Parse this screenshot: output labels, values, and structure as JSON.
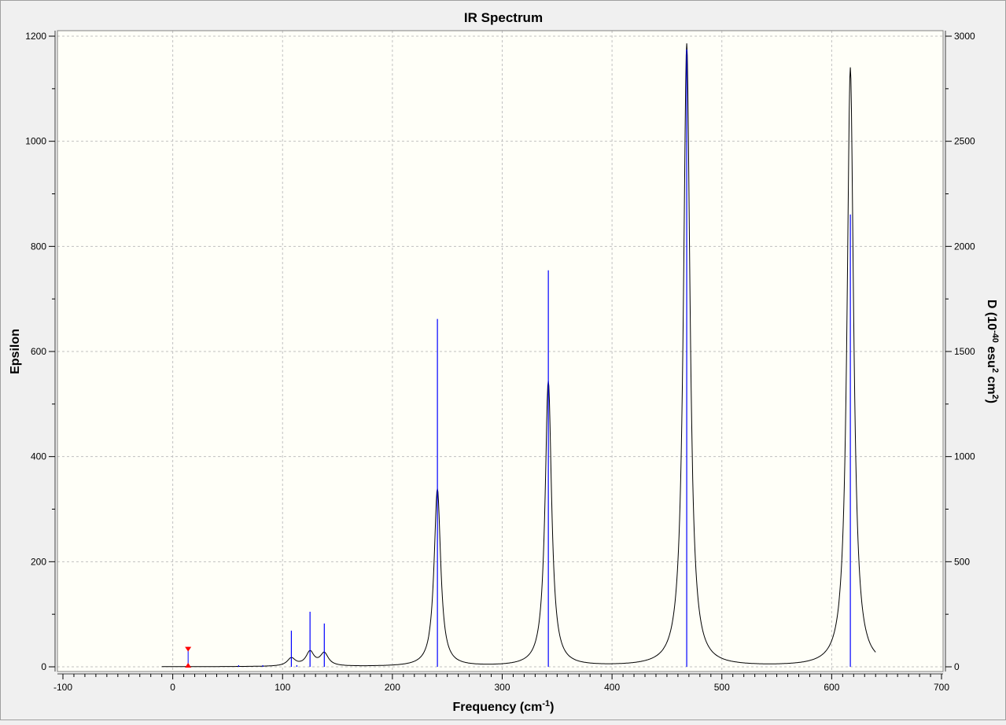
{
  "chart_data": {
    "type": "line",
    "title": "IR Spectrum",
    "xlabel": "Frequency (cm",
    "xlabel_sup": "-1",
    "xlabel_end": ")",
    "ylabel": "Epsilon",
    "y2label": "D (10",
    "y2label_sup1": "-40",
    "y2label_mid": " esu",
    "y2label_sup2": "2",
    "y2label_mid2": " cm",
    "y2label_sup3": "2",
    "y2label_end": ")",
    "xlim": [
      -100,
      700
    ],
    "ylim": [
      0,
      1200
    ],
    "y2lim": [
      0,
      3000
    ],
    "xticks": [
      -100,
      0,
      100,
      200,
      300,
      400,
      500,
      600,
      700
    ],
    "yticks": [
      0,
      200,
      400,
      600,
      800,
      1000,
      1200
    ],
    "y2ticks": [
      0,
      500,
      1000,
      1500,
      2000,
      2500,
      3000
    ],
    "grid": true,
    "curve_range": [
      -10,
      640
    ],
    "curve_baseline": 0,
    "curve_peaks": [
      {
        "freq": 108,
        "epsilon": 15
      },
      {
        "freq": 125,
        "epsilon": 27
      },
      {
        "freq": 138,
        "epsilon": 24
      },
      {
        "freq": 241,
        "epsilon": 338
      },
      {
        "freq": 342,
        "epsilon": 543
      },
      {
        "freq": 468,
        "epsilon": 1185
      },
      {
        "freq": 617,
        "epsilon": 1140
      }
    ],
    "sticks": [
      {
        "freq": 108,
        "D": 172
      },
      {
        "freq": 125,
        "D": 262
      },
      {
        "freq": 138,
        "D": 206
      },
      {
        "freq": 241,
        "D": 1655
      },
      {
        "freq": 342,
        "D": 1886
      },
      {
        "freq": 468,
        "D": 2937
      },
      {
        "freq": 617,
        "D": 2152
      },
      {
        "freq": 60,
        "D": 3
      },
      {
        "freq": 82,
        "D": 3
      },
      {
        "freq": 113,
        "D": 3
      }
    ],
    "marker": {
      "freq": 14,
      "epsilon": 38
    },
    "colors": {
      "curve": "#000000",
      "sticks": "#0000ff",
      "marker": "#ff0000",
      "plot_bg": "#fffff8",
      "grid": "#c0c0c0"
    }
  }
}
